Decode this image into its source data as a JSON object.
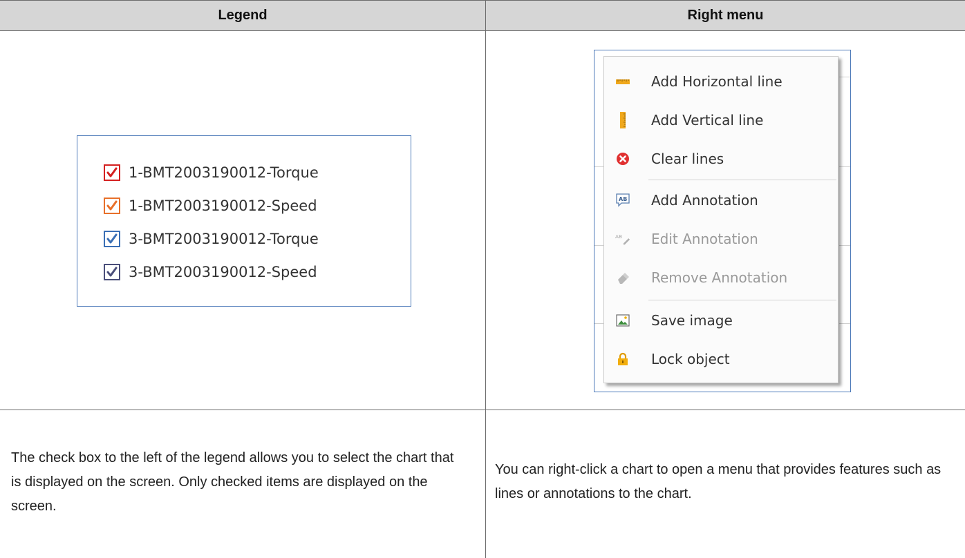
{
  "table": {
    "headers": [
      "Legend",
      "Right menu"
    ]
  },
  "legend": {
    "items": [
      {
        "label": "1-BMT2003190012-Torque",
        "color": "#d42020"
      },
      {
        "label": "1-BMT2003190012-Speed",
        "color": "#e8702a"
      },
      {
        "label": "3-BMT2003190012-Torque",
        "color": "#3a6fb5"
      },
      {
        "label": "3-BMT2003190012-Speed",
        "color": "#4a4e7a"
      }
    ]
  },
  "menu": {
    "items": [
      {
        "label": "Add Horizontal line",
        "icon": "horizontal-ruler-icon",
        "enabled": true
      },
      {
        "label": "Add Vertical line",
        "icon": "vertical-ruler-icon",
        "enabled": true
      },
      {
        "label": "Clear lines",
        "icon": "clear-circle-icon",
        "enabled": true
      },
      {
        "label": "Add Annotation",
        "icon": "annotation-add-icon",
        "enabled": true
      },
      {
        "label": "Edit Annotation",
        "icon": "annotation-edit-icon",
        "enabled": false
      },
      {
        "label": "Remove Annotation",
        "icon": "eraser-icon",
        "enabled": false
      },
      {
        "label": "Save image",
        "icon": "image-icon",
        "enabled": true
      },
      {
        "label": "Lock object",
        "icon": "lock-icon",
        "enabled": true
      }
    ]
  },
  "descriptions": {
    "left": "The check box to the left of the legend allows you to select the chart that is displayed on the screen. Only checked items are displayed on the screen.",
    "right": "You can right-click a chart to open a menu that provides features such as lines or annotations to the chart."
  },
  "colors": {
    "header_bg": "#d6d6d6",
    "frame_border": "#4a78b8",
    "disabled_text": "#9a9a9a"
  }
}
